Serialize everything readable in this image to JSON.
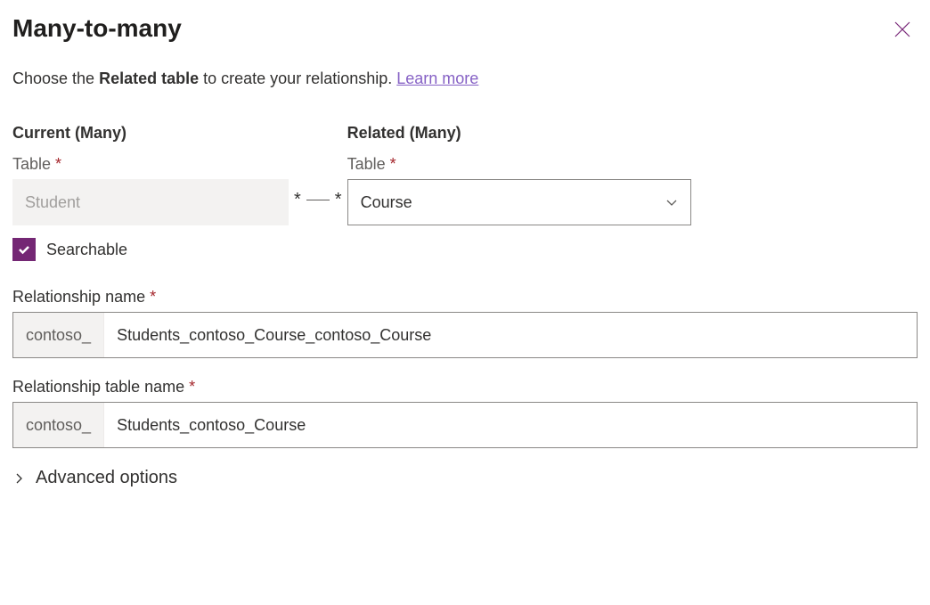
{
  "header": {
    "title": "Many-to-many"
  },
  "subtitle": {
    "pre": "Choose the ",
    "bold": "Related table",
    "post": " to create your relationship. ",
    "link": "Learn more"
  },
  "current": {
    "heading": "Current (Many)",
    "table_label": "Table",
    "table_value": "Student"
  },
  "connector": {
    "left": "*",
    "right": "*"
  },
  "related": {
    "heading": "Related (Many)",
    "table_label": "Table",
    "table_value": "Course"
  },
  "searchable": {
    "label": "Searchable",
    "checked": true
  },
  "relationship_name": {
    "label": "Relationship name",
    "prefix": "contoso_",
    "value": "Students_contoso_Course_contoso_Course"
  },
  "relationship_table_name": {
    "label": "Relationship table name",
    "prefix": "contoso_",
    "value": "Students_contoso_Course"
  },
  "advanced": {
    "label": "Advanced options"
  }
}
